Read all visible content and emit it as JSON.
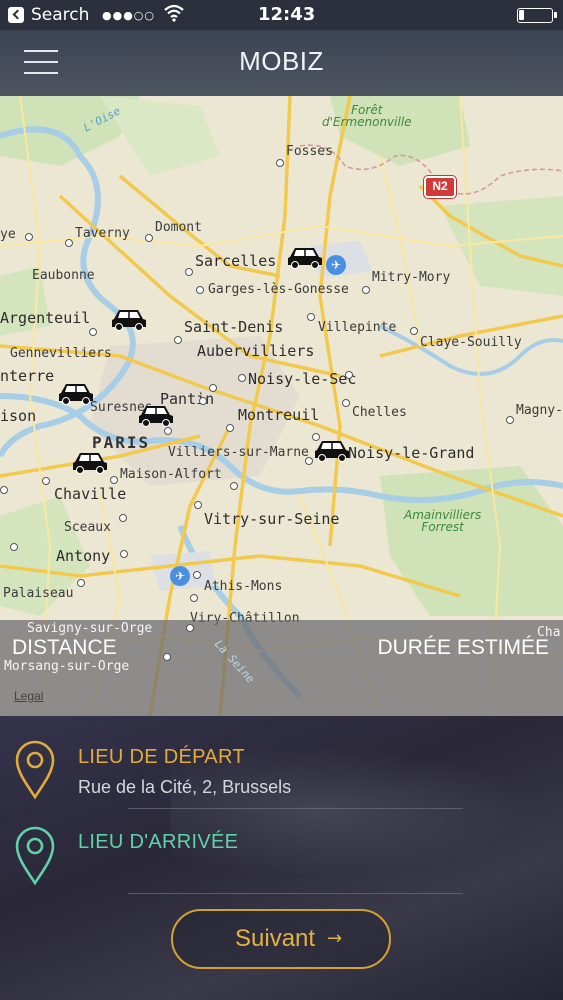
{
  "status_bar": {
    "back_app": "Search",
    "signal": "●●●○○",
    "time": "12:43",
    "battery_level": 0.15
  },
  "header": {
    "title": "MOBIZ",
    "menu_icon": "hamburger-menu-icon"
  },
  "map": {
    "places": {
      "fosses": "Fosses",
      "foret": "Forêt\nd'Ermenonville",
      "loise": "L'Oise",
      "taverny": "Taverny",
      "domont": "Domont",
      "ye": "ye",
      "sarcelles": "Sarcelles",
      "eaubonne": "Eaubonne",
      "mitry": "Mitry-Mory",
      "garges": "Garges-lès-Gonesse",
      "argenteuil": "Argenteuil",
      "saint_denis": "Saint-Denis",
      "villepinte": "Villepinte",
      "claye": "Claye-Souilly",
      "gennevilliers": "Gennevilliers",
      "aubervilliers": "Aubervilliers",
      "nterre": "nterre",
      "noisy_sec": "Noisy-le-Sec",
      "suresnes": "Suresnes",
      "pantin": "Pantin",
      "chelles": "Chelles",
      "magny": "Magny-",
      "ison": "ison",
      "montreuil": "Montreuil",
      "paris": "PARIS",
      "villiers": "Villiers-sur-Marne",
      "noisy_grand": "Noisy-le-Grand",
      "maison_alfort": "Maison-Alfort",
      "chaville": "Chaville",
      "amainvilliers": "Amainvilliers\nForrest",
      "sceaux": "Sceaux",
      "vitry": "Vitry-sur-Seine",
      "antony": "Antony",
      "athis": "Athis-Mons",
      "palaiseau": "Palaiseau",
      "viry": "Viry-Châtillon",
      "savigny": "Savigny-sur-Orge",
      "morsang": "Morsang-sur-Orge",
      "la_seine": "La Seine",
      "cha": "Cha"
    },
    "road_sign": "N2",
    "legal": "Legal",
    "distance_label": "DISTANCE",
    "duration_label": "DURÉE ESTIMÉE"
  },
  "form": {
    "start_label": "LIEU DE DÉPART",
    "start_value": "Rue de la Cité, 2, Brussels",
    "end_label": "LIEU D'ARRIVÉE",
    "end_value": "",
    "next_button": "Suivant",
    "next_arrow": "→"
  },
  "colors": {
    "start_accent": "#e2ac3b",
    "end_accent": "#5fd2a8",
    "button_border": "#d4a034"
  },
  "icons": {
    "car": "car-icon",
    "airport": "airplane-icon",
    "start_pin": "location-pin-icon",
    "end_pin": "location-pin-icon"
  }
}
